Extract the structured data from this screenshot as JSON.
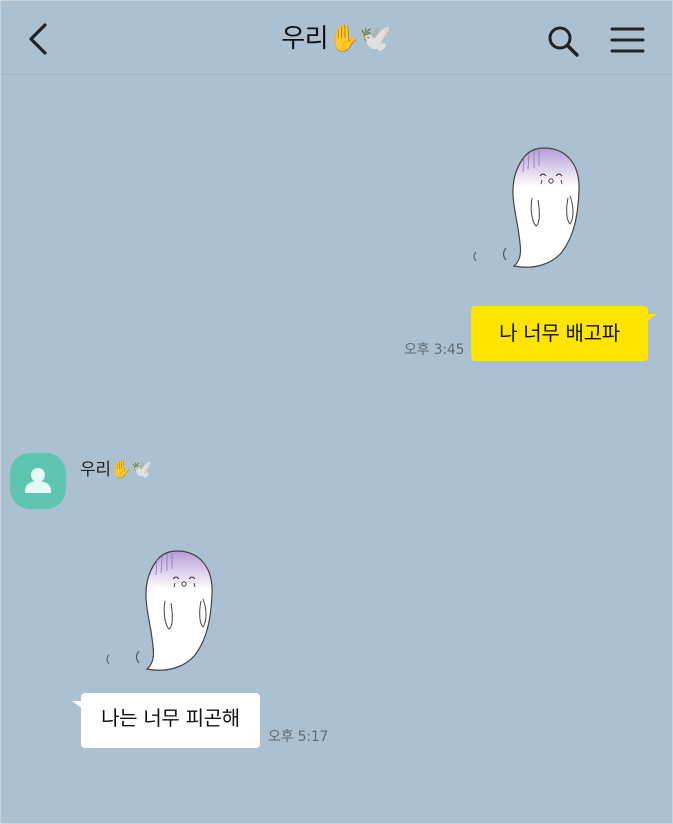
{
  "header": {
    "title": "우리✋🕊️",
    "back_icon": "chevron-left-icon",
    "search_icon": "search-icon",
    "menu_icon": "hamburger-menu-icon"
  },
  "messages": {
    "outgoing": {
      "sticker": "crying-ghost-sticker",
      "text": "나 너무 배고파",
      "time": "오후 3:45",
      "bubble_color": "#fee500"
    },
    "incoming": {
      "sender_name": "우리✋🕊️",
      "avatar_icon": "default-person-icon",
      "avatar_color": "#5ec6b0",
      "sticker": "crying-ghost-sticker",
      "text": "나는 너무 피곤해",
      "time": "오후 5:17",
      "bubble_color": "#ffffff"
    }
  },
  "theme": {
    "background": "#abc1d1"
  }
}
